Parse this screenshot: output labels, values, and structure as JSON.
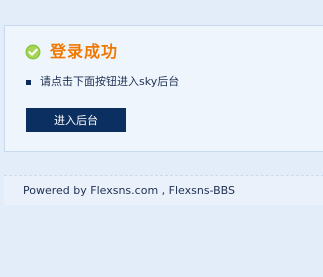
{
  "success": {
    "title": "登录成功",
    "icon": "check-circle-icon",
    "instruction": "请点击下面按钮进入sky后台",
    "button_label": "进入后台"
  },
  "footer": {
    "powered_by": "Powered by ",
    "site_link": "Flexsns.com",
    "separator": " , ",
    "product_link": "Flexsns-BBS"
  },
  "colors": {
    "page_bg": "#e3edf9",
    "panel_bg": "#eff5fd",
    "title": "#f07800",
    "button_bg": "#0c2f61",
    "text": "#1d2f52",
    "check_icon": "#8cc63f"
  }
}
